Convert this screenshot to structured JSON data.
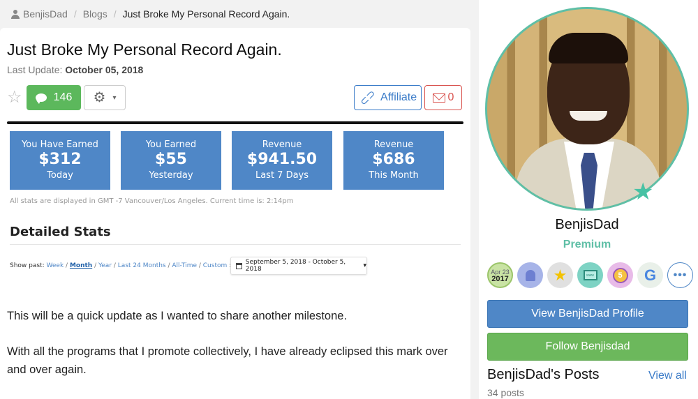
{
  "breadcrumb": {
    "user": "BenjisDad",
    "section": "Blogs",
    "current": "Just Broke My Personal Record Again."
  },
  "post": {
    "title": "Just Broke My Personal Record Again.",
    "update_label": "Last Update:",
    "update_date": "October 05, 2018",
    "comments_count": "146",
    "affiliate_label": "Affiliate",
    "flag_count": "0",
    "paragraphs": [
      "This will be a quick update as I wanted to share another milestone.",
      "With all the programs that I promote collectively, I have already eclipsed this mark over and over again."
    ]
  },
  "screenshot": {
    "stats": [
      {
        "top": "You Have Earned",
        "value": "$312",
        "bottom": "Today"
      },
      {
        "top": "You Earned",
        "value": "$55",
        "bottom": "Yesterday"
      },
      {
        "top": "Revenue",
        "value": "$941.50",
        "bottom": "Last 7 Days"
      },
      {
        "top": "Revenue",
        "value": "$686",
        "bottom": "This Month"
      }
    ],
    "note": "All stats are displayed in GMT -7 Vancouver/Los Angeles. Current time is: 2:14pm",
    "heading": "Detailed Stats",
    "show_past_label": "Show past:",
    "ranges": [
      "Week",
      "Month",
      "Year",
      "Last 24 Months",
      "All-Time",
      "Custom"
    ],
    "active_range": "Month",
    "date_range": "September 5, 2018 - October 5, 2018"
  },
  "sidebar": {
    "username": "BenjisDad",
    "membership": "Premium",
    "badges": {
      "date_month": "Apr 23",
      "date_year": "2017",
      "five": "5",
      "g": "G",
      "more": "•••",
      "www": "www"
    },
    "profile_button": "View BenjisDad Profile",
    "follow_button": "Follow Benjisdad",
    "posts_title": "BenjisDad's Posts",
    "view_all": "View all",
    "posts_count": "34 posts"
  },
  "icons": {
    "star": "star-outline-icon",
    "comment": "comment-bubble-icon",
    "gear": "gear-icon",
    "link": "link-icon",
    "mail": "envelope-icon"
  },
  "colors": {
    "green": "#5cb85c",
    "blue": "#4f87c7",
    "red": "#d9534f",
    "teal": "#5fbfa6"
  }
}
